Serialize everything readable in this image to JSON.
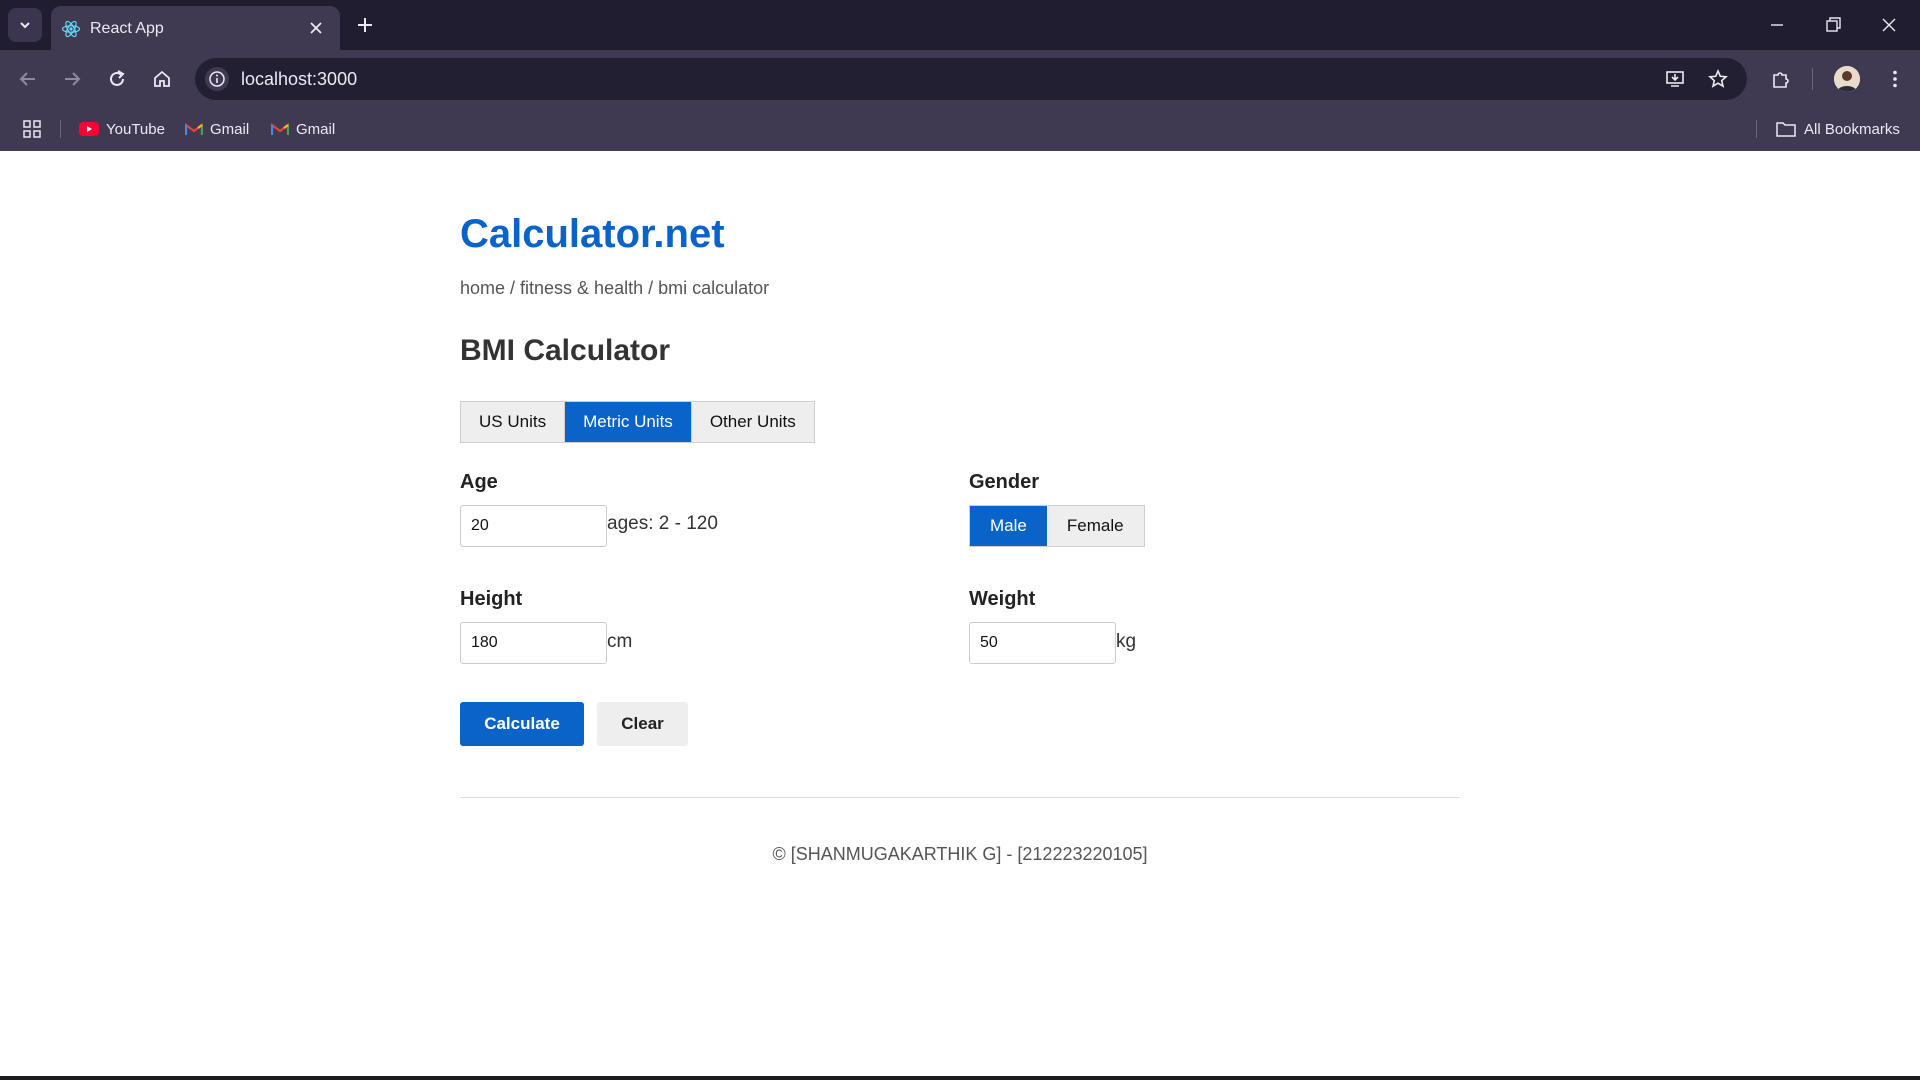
{
  "browser": {
    "tab_title": "React App",
    "url": "localhost:3000",
    "bookmarks": [
      {
        "label": "YouTube",
        "icon": "youtube-icon"
      },
      {
        "label": "Gmail",
        "icon": "gmail-icon"
      },
      {
        "label": "Gmail",
        "icon": "gmail-icon"
      }
    ],
    "all_bookmarks": "All Bookmarks"
  },
  "site": {
    "title": "Calculator.net",
    "breadcrumb": "home / fitness & health / bmi calculator",
    "heading": "BMI Calculator"
  },
  "units": {
    "tabs": [
      "US Units",
      "Metric Units",
      "Other Units"
    ],
    "active": "Metric Units"
  },
  "form": {
    "age": {
      "label": "Age",
      "value": "20",
      "hint": "ages: 2 - 120"
    },
    "gender": {
      "label": "Gender",
      "options": [
        "Male",
        "Female"
      ],
      "selected": "Male"
    },
    "height": {
      "label": "Height",
      "value": "180",
      "unit": "cm"
    },
    "weight": {
      "label": "Weight",
      "value": "50",
      "unit": "kg"
    }
  },
  "actions": {
    "calculate": "Calculate",
    "clear": "Clear"
  },
  "footer": {
    "text": "© [SHANMUGAKARTHIK G] - [212223220105]"
  },
  "colors": {
    "accent": "#0a63c9",
    "chrome_dark": "#211d31",
    "chrome": "#3f3952"
  }
}
